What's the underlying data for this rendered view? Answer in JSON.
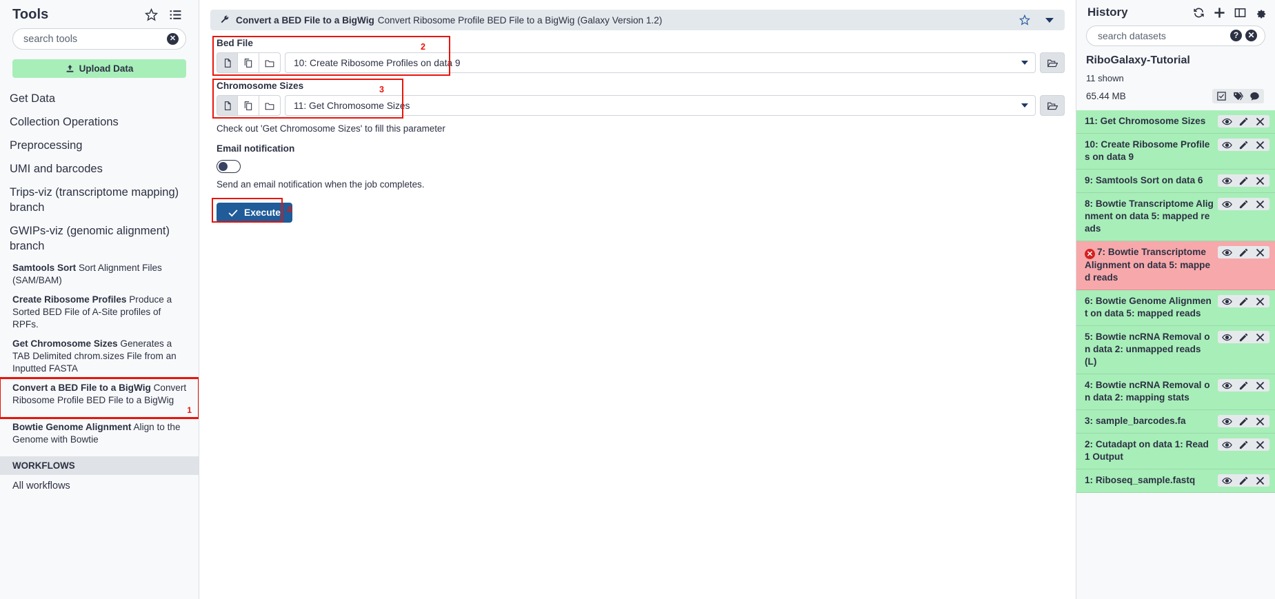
{
  "tools": {
    "title": "Tools",
    "favorites_icon": "star-icon",
    "list_icon": "list-icon",
    "search_placeholder": "search tools",
    "search_value": "",
    "clear_icon": "clear-icon",
    "upload_label": "Upload Data",
    "upload_icon": "upload-icon",
    "sections": [
      {
        "label": "Get Data"
      },
      {
        "label": "Collection Operations"
      },
      {
        "label": "Preprocessing"
      },
      {
        "label": "UMI and barcodes"
      },
      {
        "label": "Trips-viz (transcriptome mapping) branch"
      },
      {
        "label": "GWIPs-viz (genomic alignment) branch"
      }
    ],
    "items": [
      {
        "name": "Samtools Sort",
        "desc": "Sort Alignment Files (SAM/BAM)",
        "highlighted": false
      },
      {
        "name": "Create Ribosome Profiles",
        "desc": "Produce a Sorted BED File of A-Site profiles of RPFs.",
        "highlighted": false
      },
      {
        "name": "Get Chromosome Sizes",
        "desc": "Generates a TAB Delimited chrom.sizes File from an Inputted FASTA",
        "highlighted": false
      },
      {
        "name": "Convert a BED File to a BigWig",
        "desc": "Convert Ribosome Profile BED File to a BigWig",
        "highlighted": true,
        "marker": "1"
      },
      {
        "name": "Bowtie Genome Alignment",
        "desc": "Align to the Genome with Bowtie",
        "highlighted": false
      }
    ],
    "workflows_header": "WORKFLOWS",
    "workflows_item": "All workflows"
  },
  "tool_form": {
    "header": {
      "icon": "wrench-icon",
      "title": "Convert a BED File to a BigWig",
      "subtitle": "Convert Ribosome Profile BED File to a BigWig (Galaxy Version 1.2)",
      "favorite_icon": "star-icon",
      "options_icon": "chevron-down-icon"
    },
    "fields": [
      {
        "label": "Bed File",
        "value": "10: Create Ribosome Profiles on data 9",
        "marker": "2",
        "mode_icons": [
          "single-dataset-icon",
          "multiple-datasets-icon",
          "dataset-collection-icon"
        ],
        "browse_icon": "folder-open-icon"
      },
      {
        "label": "Chromosome Sizes",
        "value": "11: Get Chromosome Sizes",
        "marker": "3",
        "help": "Check out 'Get Chromosome Sizes' to fill this parameter",
        "mode_icons": [
          "single-dataset-icon",
          "multiple-datasets-icon",
          "dataset-collection-icon"
        ],
        "browse_icon": "folder-open-icon"
      }
    ],
    "email": {
      "label": "Email notification",
      "toggle_state": "off",
      "help": "Send an email notification when the job completes."
    },
    "execute": {
      "label": "Execute",
      "icon": "check-icon",
      "marker": "4",
      "color": "#1f5c99"
    }
  },
  "history": {
    "title": "History",
    "icons": [
      "refresh-icon",
      "plus-icon",
      "switch-history-icon",
      "gear-icon"
    ],
    "search_placeholder": "search datasets",
    "search_value": "",
    "help_icon": "help-icon",
    "clear_icon": "clear-icon",
    "name": "RiboGalaxy-Tutorial",
    "shown": "11 shown",
    "size": "65.44 MB",
    "size_icons": [
      "select-items-icon",
      "tags-icon",
      "annotation-icon"
    ],
    "item_icons": [
      "eye-icon",
      "pencil-icon",
      "delete-icon"
    ],
    "datasets": [
      {
        "label": "11: Get Chromosome Sizes",
        "state": "ok"
      },
      {
        "label": "10: Create Ribosome Profiles on data 9",
        "state": "ok"
      },
      {
        "label": "9: Samtools Sort on data 6",
        "state": "ok"
      },
      {
        "label": "8: Bowtie Transcriptome Alignment on data 5: mapped reads",
        "state": "ok"
      },
      {
        "label": "7: Bowtie Transcriptome Alignment on data 5: mapped reads",
        "state": "error"
      },
      {
        "label": "6: Bowtie Genome Alignment on data 5: mapped reads",
        "state": "ok"
      },
      {
        "label": "5: Bowtie ncRNA Removal on data 2: unmapped reads (L)",
        "state": "ok"
      },
      {
        "label": "4: Bowtie ncRNA Removal on data 2: mapping stats",
        "state": "ok"
      },
      {
        "label": "3: sample_barcodes.fa",
        "state": "ok"
      },
      {
        "label": "2: Cutadapt on data 1: Read 1 Output",
        "state": "ok"
      },
      {
        "label": "1: Riboseq_sample.fastq",
        "state": "ok"
      }
    ]
  },
  "colors": {
    "highlight": "#e8140c",
    "ok_state": "#a8eeb9",
    "error_state": "#f7a8ab",
    "execute_blue": "#1f5c99"
  }
}
